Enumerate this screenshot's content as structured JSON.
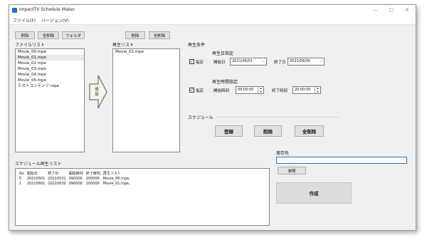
{
  "window": {
    "title": "ImpactTV Schedule Maker",
    "minimize": "—",
    "maximize": "□",
    "close": "✕"
  },
  "menu": [
    "ファイル(F)",
    "バージョン(V)"
  ],
  "left_panel": {
    "buttons": [
      "削除",
      "全削除",
      "フォルダ"
    ],
    "label": "ファイルリスト",
    "files": [
      "Movie_00.mpe",
      "Movie_01.mpe",
      "Movie_02.mpe",
      "Movie_03.mpe",
      "Movie_04.mpe",
      "Movie_05.mpe",
      "テストコンテンツ.mpe"
    ],
    "selected_index": 1
  },
  "add_button": {
    "label": "追加"
  },
  "middle_panel": {
    "buttons": [
      "削除",
      "全削除"
    ],
    "label": "再生リスト",
    "items": [
      "Movie_02.mpe"
    ]
  },
  "conditions": {
    "label": "再生条件",
    "date_group_label": "再生日指定",
    "date_check": {
      "label": "指定",
      "checked": true
    },
    "start_date_label": "開始日",
    "start_date": "2021/06/01",
    "end_date_label": "終了日",
    "end_date": "2021/06/30",
    "time_group_label": "再生時間指定",
    "time_check": {
      "label": "指定",
      "checked": true
    },
    "start_time_label": "開始時刻",
    "start_time": "09:00:00",
    "end_time_label": "終了時刻",
    "end_time": "20:00:00"
  },
  "schedule": {
    "label": "スケジュール",
    "buttons": [
      "登録",
      "削除",
      "全削除"
    ]
  },
  "schedule_list": {
    "label": "スケジュール再生リスト",
    "headers": [
      "No",
      "開始日",
      "終了日",
      "開始時刻",
      "終了時刻",
      "再生リスト"
    ],
    "rows": [
      [
        "0",
        "20210501",
        "20210531",
        "090000",
        "200000",
        "Movie_00.mpe,"
      ],
      [
        "1",
        "20210601",
        "20210630",
        "090000",
        "200000",
        "Movie_01.mpe,"
      ]
    ]
  },
  "save": {
    "label": "保存先",
    "path_value": "",
    "browse_label": "参照",
    "create_label": "作成"
  }
}
